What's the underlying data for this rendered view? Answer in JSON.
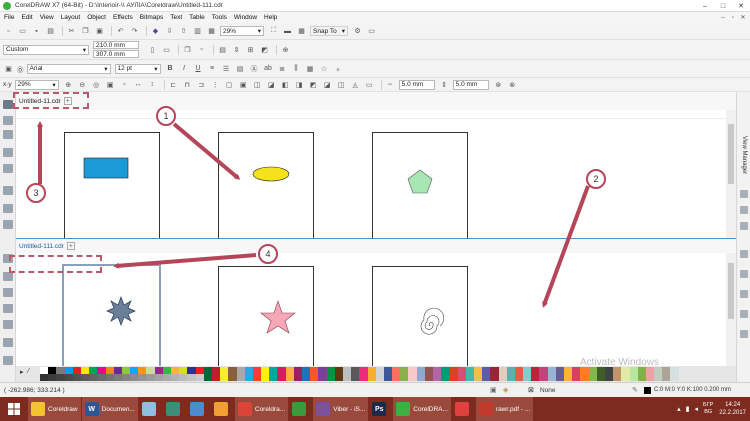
{
  "window": {
    "title": "CorelDRAW X7 (64-Bit) - D:\\Interioir-\\\\ АУЛІА\\Coreldraw\\Untitled-111.cdr"
  },
  "menu": [
    "File",
    "Edit",
    "View",
    "Layout",
    "Object",
    "Effects",
    "Bitmaps",
    "Text",
    "Table",
    "Tools",
    "Window",
    "Help"
  ],
  "toolbar": {
    "zoom": "29%",
    "snap_to": "Snap To",
    "page_preset": "Custom",
    "width": "210.0 mm",
    "height": "307.0 mm"
  },
  "text_toolbar": {
    "font": "Arial",
    "size": "12 pt"
  },
  "property_bar": {
    "zoom2": "29%",
    "dup_x": "5.0 mm",
    "dup_y": "5.0 mm"
  },
  "docs": {
    "top_tab": "Untitled-11.cdr",
    "bottom_tab": "Untitled-111.cdr",
    "add_tab": "+"
  },
  "docker": {
    "view_manager": "View Manager"
  },
  "annotations": [
    "1",
    "2",
    "3",
    "4"
  ],
  "status": {
    "coords": "( -262.986; 333.214 )",
    "fill": "None",
    "outline": "C:0 M:0 Y:0 K:100  0.200 mm"
  },
  "watermark": "Activate Windows",
  "taskbar": {
    "items": [
      {
        "label": "Coreldraw",
        "color": "#f4c430",
        "glyph": ""
      },
      {
        "label": "Documen...",
        "color": "#2b5797",
        "glyph": "W"
      },
      {
        "label": "",
        "color": "#8fbfe0",
        "glyph": ""
      },
      {
        "label": "",
        "color": "#3c8d7a",
        "glyph": ""
      },
      {
        "label": "",
        "color": "#4a8bd1",
        "glyph": ""
      },
      {
        "label": "",
        "color": "#f0a030",
        "glyph": ""
      },
      {
        "label": "Coreldra...",
        "color": "#db4437",
        "glyph": ""
      },
      {
        "label": "",
        "color": "#3c9a3c",
        "glyph": ""
      },
      {
        "label": "Viber - iS...",
        "color": "#7b519d",
        "glyph": ""
      },
      {
        "label": "",
        "color": "#1b2a4a",
        "glyph": "Ps"
      },
      {
        "label": "CorelDRA...",
        "color": "#3cb043",
        "glyph": ""
      },
      {
        "label": "",
        "color": "#e04040",
        "glyph": ""
      },
      {
        "label": "rawr.pdf - ...",
        "color": "#c0392b",
        "glyph": ""
      }
    ],
    "lang": "БГР\nBG",
    "time": "14:24",
    "date": "22.2.2017"
  },
  "colors": {
    "rect_fill": "#1a9ad6",
    "ellipse_fill": "#f5e21b",
    "pentagon_fill": "#a8e6b4",
    "star8_fill": "#6c7f9a",
    "star5_fill": "#f7a8b6",
    "arrow": "#b5465a"
  }
}
